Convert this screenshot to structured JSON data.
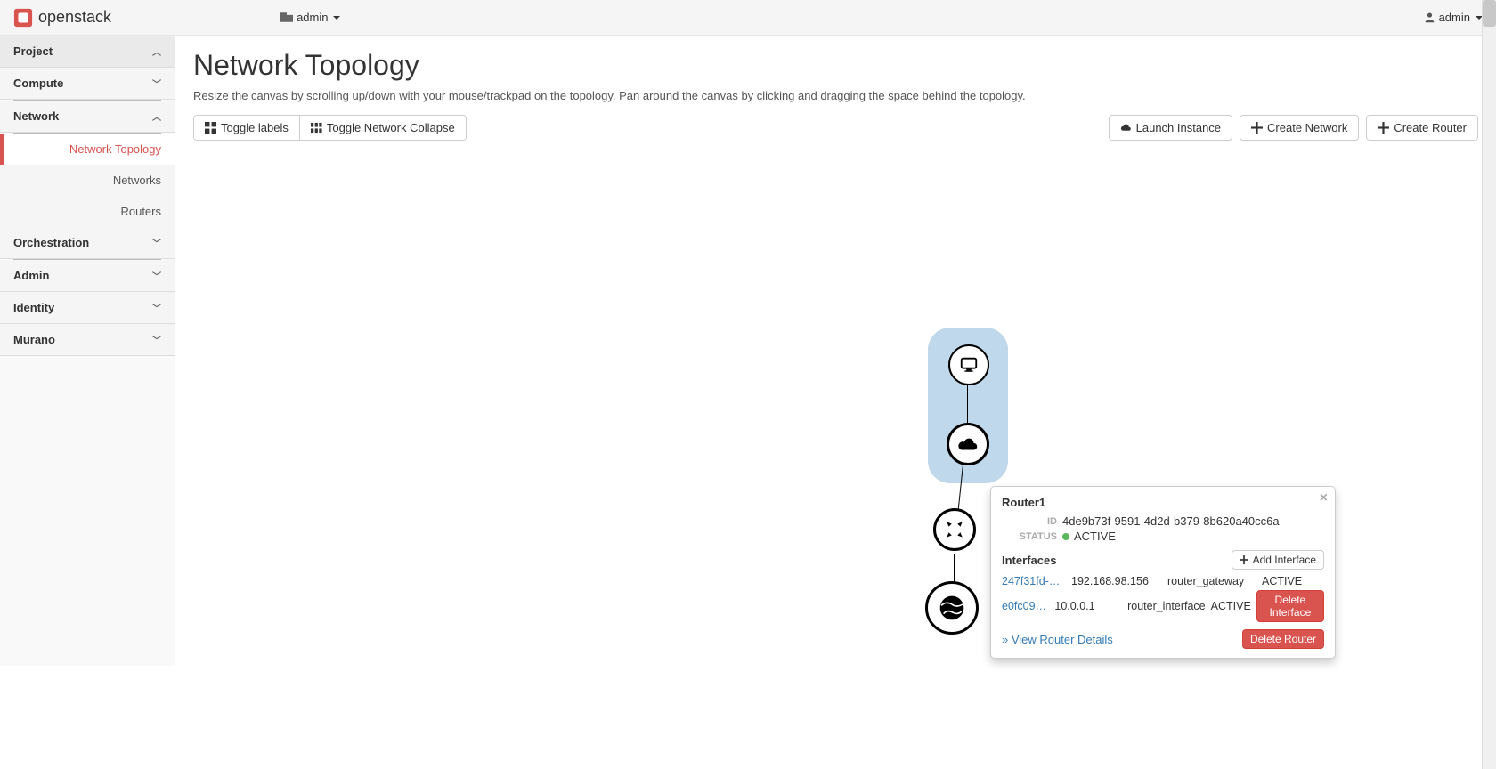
{
  "navbar": {
    "brand": "openstack",
    "project_selector": "admin",
    "user_menu": "admin"
  },
  "sidebar": {
    "top": {
      "label": "Project",
      "expanded": true
    },
    "compute": {
      "label": "Compute",
      "expanded": false
    },
    "network": {
      "label": "Network",
      "expanded": true,
      "items": {
        "topology": "Network Topology",
        "networks": "Networks",
        "routers": "Routers"
      }
    },
    "orchestration": {
      "label": "Orchestration"
    },
    "admin": {
      "label": "Admin"
    },
    "identity": {
      "label": "Identity"
    },
    "murano": {
      "label": "Murano"
    }
  },
  "page": {
    "title": "Network Topology",
    "help": "Resize the canvas by scrolling up/down with your mouse/trackpad on the topology. Pan around the canvas by clicking and dragging the space behind the topology."
  },
  "toolbar": {
    "toggle_labels": "Toggle labels",
    "toggle_collapse": "Toggle Network Collapse",
    "launch_instance": "Launch Instance",
    "create_network": "Create Network",
    "create_router": "Create Router"
  },
  "popover": {
    "title": "Router1",
    "id_label": "ID",
    "id": "4de9b73f-9591-4d2d-b379-8b620a40cc6a",
    "status_label": "STATUS",
    "status": "ACTIVE",
    "interfaces_label": "Interfaces",
    "add_interface": "Add Interface",
    "interfaces": [
      {
        "id": "247f31fd-5…",
        "ip": "192.168.98.156",
        "type": "router_gateway",
        "status": "ACTIVE",
        "action": ""
      },
      {
        "id": "e0fc09be-c…",
        "ip": "10.0.0.1",
        "type": "router_interface",
        "status": "ACTIVE",
        "action": "Delete Interface"
      }
    ],
    "view_details": "» View Router Details",
    "delete_router": "Delete Router"
  }
}
